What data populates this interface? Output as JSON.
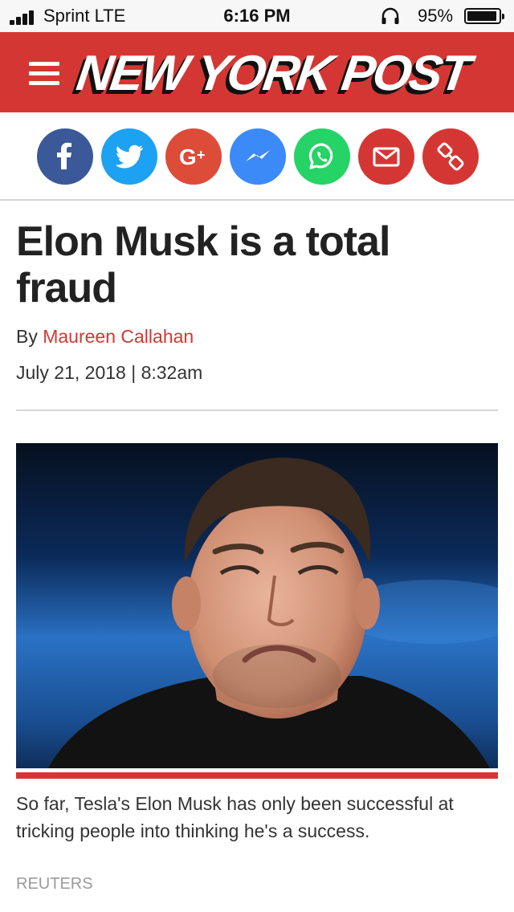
{
  "status_bar": {
    "carrier": "Sprint  LTE",
    "time": "6:16 PM",
    "battery_percent": "95%",
    "battery_level": 0.95,
    "signal_bars": 4
  },
  "header": {
    "logo_text": "NEW YORK POST",
    "background_color": "#d43733"
  },
  "share_buttons": [
    {
      "name": "facebook",
      "icon": "facebook-icon",
      "color": "#3b5998"
    },
    {
      "name": "twitter",
      "icon": "twitter-icon",
      "color": "#1da1f2"
    },
    {
      "name": "google-plus",
      "icon": "google-plus-icon",
      "color": "#dd4b39"
    },
    {
      "name": "messenger",
      "icon": "messenger-icon",
      "color": "#3b8af7"
    },
    {
      "name": "whatsapp",
      "icon": "whatsapp-icon",
      "color": "#25d366"
    },
    {
      "name": "email",
      "icon": "envelope-icon",
      "color": "#d43733"
    },
    {
      "name": "copy-link",
      "icon": "link-icon",
      "color": "#d43733"
    }
  ],
  "article": {
    "headline": "Elon Musk is a total fraud",
    "byline_prefix": "By",
    "author": "Maureen Callahan",
    "dateline": "July 21, 2018 | 8:32am",
    "caption": "So far, Tesla's Elon Musk has only been successful at tricking people into thinking he's a success.",
    "photo_credit": "REUTERS"
  }
}
